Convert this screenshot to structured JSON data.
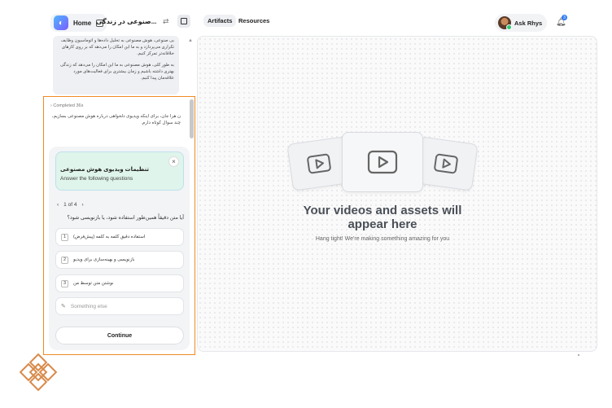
{
  "header": {
    "home_label": "Home",
    "doc_title": "...صنوعی در زندگی",
    "tabs": [
      {
        "label": "Artifacts"
      },
      {
        "label": "Resources"
      }
    ],
    "user_name": "Ask Rhys",
    "notification_count": "3"
  },
  "chat": {
    "snippet_1": "بی صنوعی، هوش مصنوعی به تحلیل داده‌ها و اتوماسیون وظایف تکراری می‌پردازد و به ما این امکان را می‌دهد که بر روی کارهای خلاقانه‌تر تمرکز کنیم.",
    "snippet_2": "به طور کلی، هوش مصنوعی به ما این امکان را می‌دهد که زندگی بهتری داشته باشیم و زمان بیشتری برای فعالیت‌های مورد علاقه‌مان پیدا کنیم.",
    "completed": "Completed 36s",
    "completed_text": "ن هرا جان، برای اینکه ویدیوی دلخواهی درباره هوش مصنوعی بسازیم، چند سوال کوتاه دارم."
  },
  "questionnaire": {
    "title": "تنظیمات ویدیوی هوش مصنوعی",
    "subtitle": "Answer the following questions",
    "pager": "1 of 4",
    "question": "آیا متن دقیقاً همین‌طور استفاده شود، یا بازنویسی شود؟",
    "options": [
      {
        "num": "1",
        "text": "استفاده دقیق کلمه به کلمه (پیش‌فرض)"
      },
      {
        "num": "2",
        "text": "بازنویسی و بهینه‌سازی برای ویدیو"
      },
      {
        "num": "3",
        "text": "نوشتن متن توسط من"
      }
    ],
    "other": "Something else",
    "continue": "Continue"
  },
  "canvas": {
    "title": "Your videos and assets will appear here",
    "subtitle": "Hang tight! We're making something amazing for you"
  },
  "colors": {
    "highlight": "#f08a24",
    "accent": "#2f7bf6"
  }
}
